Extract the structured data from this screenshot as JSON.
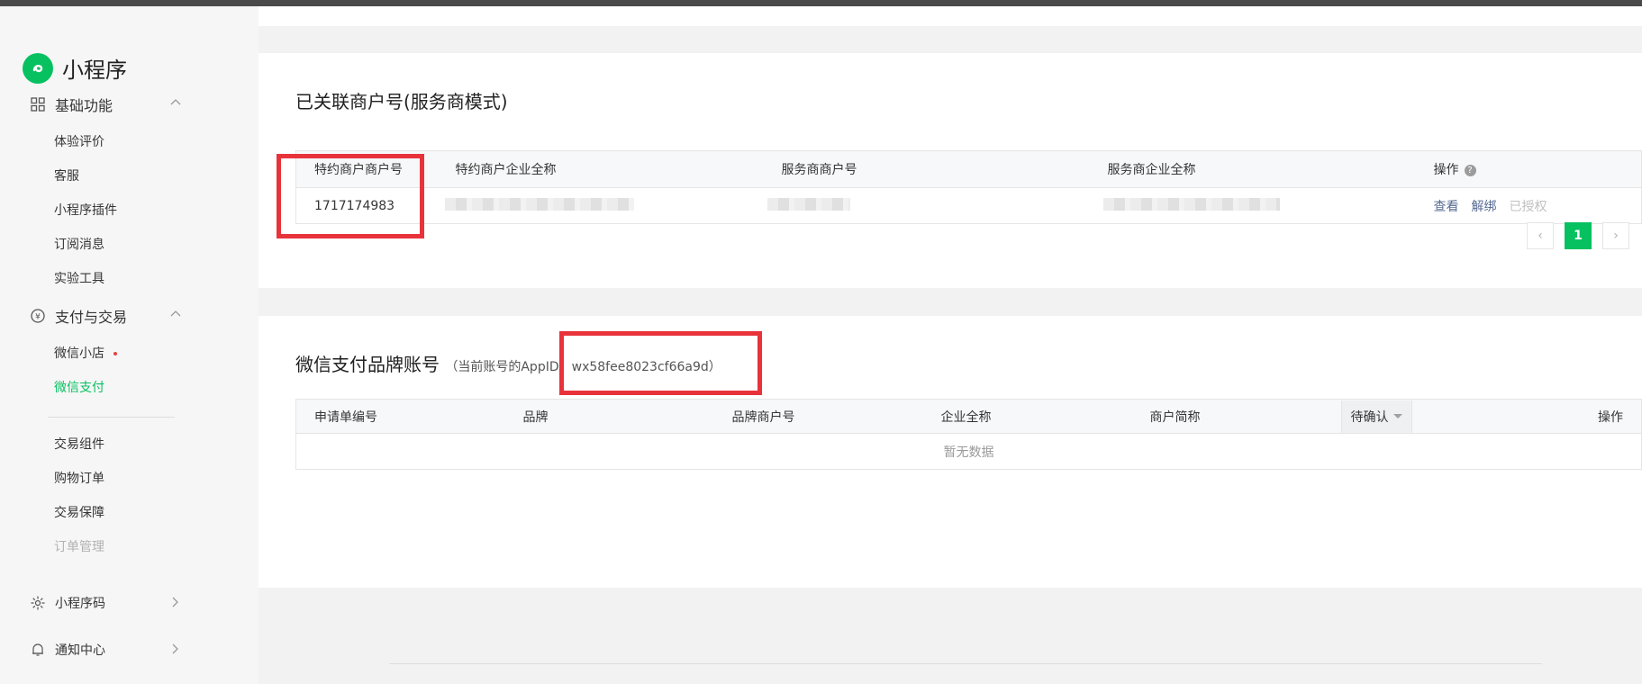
{
  "app": {
    "title": "小程序"
  },
  "sidebar": {
    "groups": [
      {
        "label": "基础功能",
        "icon": "grid-icon",
        "expanded": true
      },
      {
        "label": "支付与交易",
        "icon": "yen-circle-icon",
        "expanded": true
      },
      {
        "label": "小程序码",
        "icon": "sun-icon",
        "expanded": false
      },
      {
        "label": "通知中心",
        "icon": "bell-icon",
        "expanded": false
      }
    ],
    "basic_items": [
      "体验评价",
      "客服",
      "小程序插件",
      "订阅消息",
      "实验工具"
    ],
    "pay_items": [
      "微信小店",
      "微信支付",
      "交易组件",
      "购物订单",
      "交易保障",
      "订单管理"
    ],
    "active_item": "微信支付"
  },
  "merchants": {
    "title": "已关联商户号(服务商模式)",
    "columns": [
      "特约商户商户号",
      "特约商户企业全称",
      "服务商商户号",
      "服务商企业全称",
      "操作"
    ],
    "rows": [
      {
        "merchant_id": "1717174983",
        "actions": [
          "查看",
          "解绑"
        ],
        "status": "已授权"
      }
    ],
    "pagination": {
      "prev": "‹",
      "current": "1",
      "next": "›"
    }
  },
  "brand": {
    "title": "微信支付品牌账号",
    "subtitle_prefix": "（当前账号的AppID：",
    "appid": "wx58fee8023cf66a9d",
    "subtitle_suffix": "）",
    "columns": [
      "申请单编号",
      "品牌",
      "品牌商户号",
      "企业全称",
      "商户简称",
      "待确认",
      "操作"
    ],
    "empty_text": "暂无数据"
  },
  "colors": {
    "accent": "#07c160",
    "link": "#576b95",
    "highlight": "#e8333b"
  }
}
